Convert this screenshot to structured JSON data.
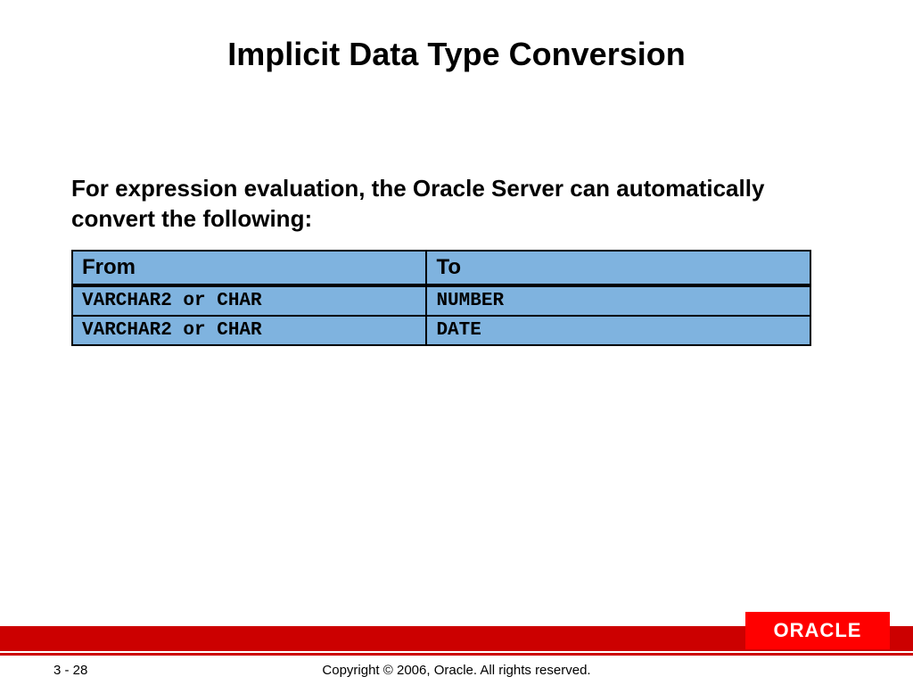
{
  "title": "Implicit Data Type Conversion",
  "subtitle": "For expression evaluation, the Oracle Server can automatically convert the following:",
  "table": {
    "headers": {
      "from": "From",
      "to": "To"
    },
    "rows": [
      {
        "from": "VARCHAR2 or CHAR",
        "to": "NUMBER"
      },
      {
        "from": "VARCHAR2 or CHAR",
        "to": "DATE"
      }
    ]
  },
  "logo_text": "ORACLE",
  "page_number": "3 - 28",
  "copyright": "Copyright © 2006, Oracle. All rights reserved."
}
